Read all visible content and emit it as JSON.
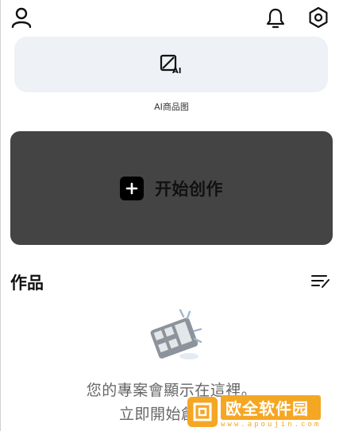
{
  "ai_tool": {
    "label": "AI商品图",
    "badge": "AI"
  },
  "create": {
    "label": "开始创作"
  },
  "works": {
    "title": "作品"
  },
  "empty_state": {
    "line1": "您的專案會顯示在這裡。",
    "line2": "立即開始創作"
  },
  "watermark": {
    "text": "欧全软件园",
    "url": "www.apoujin.com"
  },
  "icons": {
    "profile": "user-icon",
    "notifications": "bell-icon",
    "settings": "gear-icon",
    "ai_tool": "ai-image-icon",
    "create": "plus-icon",
    "sort": "sort-edit-icon",
    "empty": "film-icon"
  },
  "colors": {
    "card_bg": "#eef1f5",
    "create_bg": "#444444",
    "text_secondary": "#666666",
    "watermark": "#f5a623"
  }
}
